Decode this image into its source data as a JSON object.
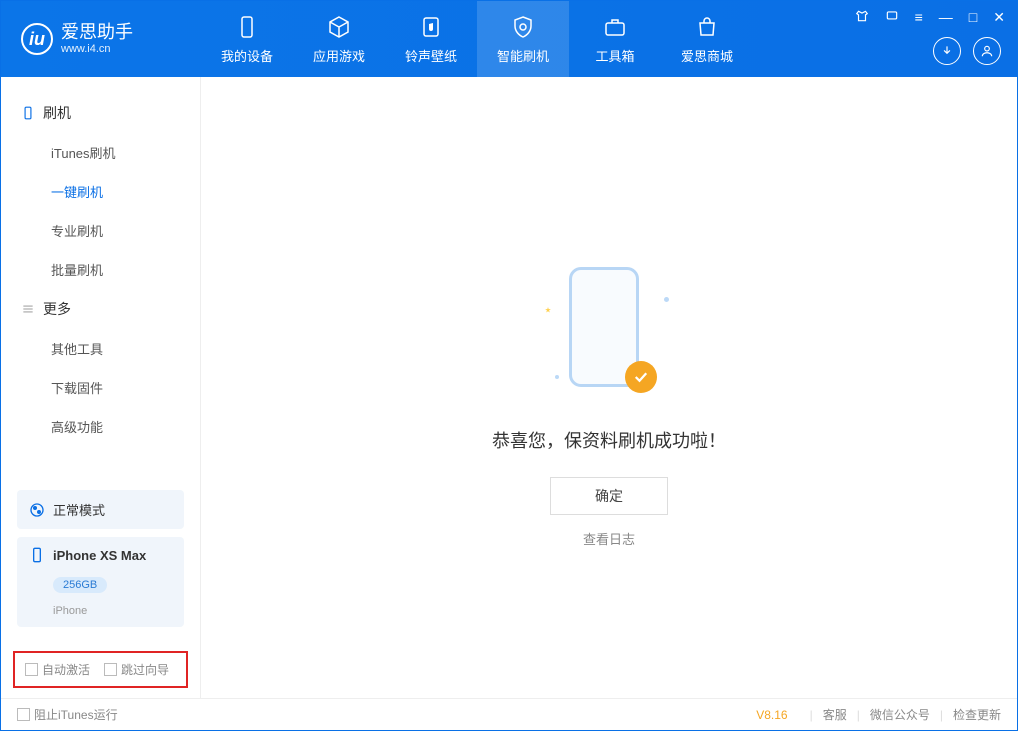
{
  "app": {
    "title": "爱思助手",
    "subtitle": "www.i4.cn"
  },
  "tabs": {
    "device": "我的设备",
    "apps": "应用游戏",
    "ring": "铃声壁纸",
    "flash": "智能刷机",
    "tools": "工具箱",
    "store": "爱思商城"
  },
  "sidebar": {
    "section_flash": "刷机",
    "items_flash": {
      "itunes": "iTunes刷机",
      "oneclick": "一键刷机",
      "pro": "专业刷机",
      "batch": "批量刷机"
    },
    "section_more": "更多",
    "items_more": {
      "other": "其他工具",
      "firmware": "下载固件",
      "advanced": "高级功能"
    }
  },
  "device": {
    "mode": "正常模式",
    "name": "iPhone XS Max",
    "capacity": "256GB",
    "type": "iPhone"
  },
  "checkboxes": {
    "auto_activate": "自动激活",
    "skip_guide": "跳过向导"
  },
  "main": {
    "success": "恭喜您，保资料刷机成功啦！",
    "ok": "确定",
    "view_log": "查看日志"
  },
  "footer": {
    "block_itunes": "阻止iTunes运行",
    "version": "V8.16",
    "support": "客服",
    "wechat": "微信公众号",
    "update": "检查更新"
  }
}
